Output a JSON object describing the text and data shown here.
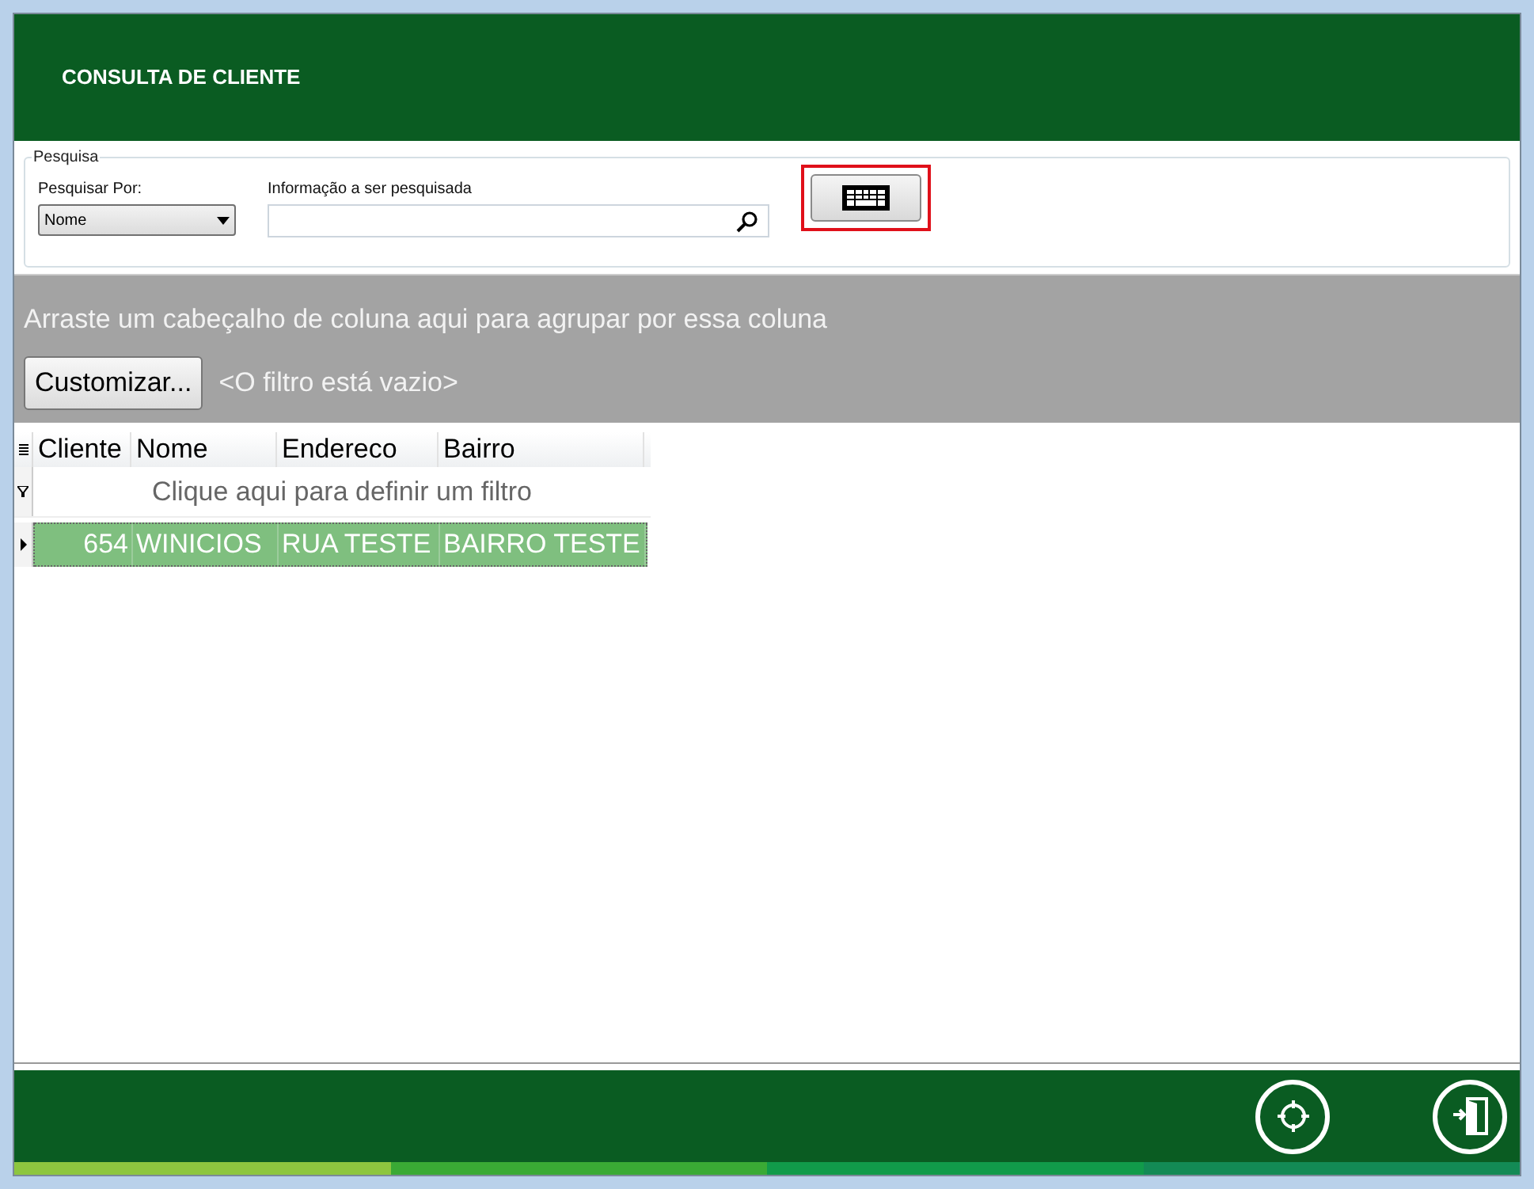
{
  "header": {
    "title": "CONSULTA DE CLIENTE"
  },
  "search": {
    "legend": "Pesquisa",
    "search_by_label": "Pesquisar Por:",
    "search_by_value": "Nome",
    "query_label": "Informação a ser pesquisada",
    "highlighted_keyboard": true
  },
  "grid": {
    "group_hint": "Arraste um cabeçalho de coluna aqui para agrupar por essa coluna",
    "customize_button": "Customizar...",
    "filter_text": "<O filtro está vazio>",
    "columns": [
      "Cliente",
      "Nome",
      "Endereco",
      "Bairro"
    ],
    "filter_row": "Clique aqui para definir um filtro",
    "rows": [
      {
        "cells": [
          "654",
          "WINICIOS",
          "RUA TESTE",
          "BAIRRO TESTE"
        ],
        "selected": true
      }
    ]
  }
}
